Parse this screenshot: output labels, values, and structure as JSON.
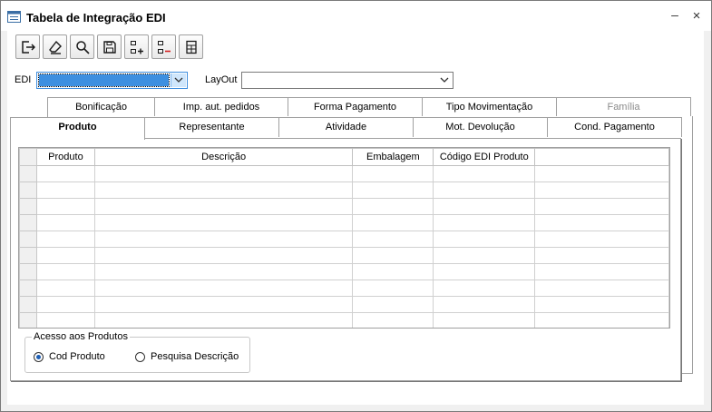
{
  "window": {
    "title": "Tabela de Integração EDI",
    "minimize": "–",
    "close": "×"
  },
  "toolbar": [
    {
      "name": "exit-icon"
    },
    {
      "name": "eraser-icon"
    },
    {
      "name": "search-icon"
    },
    {
      "name": "save-icon"
    },
    {
      "name": "add-row-icon"
    },
    {
      "name": "remove-row-icon"
    },
    {
      "name": "calculator-icon"
    }
  ],
  "filters": {
    "edi_label": "EDI",
    "edi_value": "",
    "layout_label": "LayOut",
    "layout_value": ""
  },
  "tabs_back": [
    "Bonificação",
    "Imp. aut. pedidos",
    "Forma Pagamento",
    "Tipo Movimentação",
    "Família"
  ],
  "tabs_front": [
    "Produto",
    "Representante",
    "Atividade",
    "Mot. Devolução",
    "Cond. Pagamento"
  ],
  "grid": {
    "columns": [
      "Produto",
      "Descrição",
      "Embalagem",
      "Código EDI Produto",
      ""
    ],
    "rows": 10
  },
  "access": {
    "title": "Acesso aos Produtos",
    "option1": "Cod Produto",
    "option2": "Pesquisa Descrição",
    "selected": "option1"
  }
}
